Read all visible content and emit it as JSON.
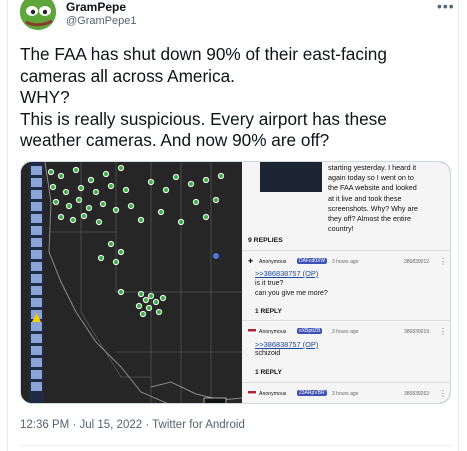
{
  "author": {
    "name": "GramPepe",
    "handle": "@GramPepe1"
  },
  "more_glyph": "•••",
  "tweet_lines": [
    "The FAA has shut down 90% of their east-facing",
    "cameras all across America.",
    "WHY?",
    "This is really suspicious. Every airport has these",
    "weather cameras. And now 90% are off?"
  ],
  "screenshot": {
    "op_lines": [
      "starting yesterday. I heard it",
      "again today so I went on to",
      "the FAA website and looked",
      "at it live and took these",
      "screenshots. Why? Why are",
      "they off? Almost the entire",
      "country!"
    ],
    "op_replies": "9 REPLIES",
    "posts": [
      {
        "user": "Anonymous",
        "id": "DAFcd0XW",
        "time": "3 hours ago",
        "number": "386839012",
        "quote": ">>386838757 (OP)",
        "lines": [
          "is it true?",
          "can you give me more?"
        ],
        "replies": "1 REPLY"
      },
      {
        "user": "Anonymous",
        "id": "eXBpttZB",
        "time": "3 hours ago",
        "number": "386839019",
        "quote": ">>386838757 (OP)",
        "lines": [
          "schizoid"
        ],
        "replies": "1 REPLY"
      },
      {
        "user": "Anonymous",
        "id": "23ARpVBR",
        "time": "3 hours ago",
        "number": "386839263"
      }
    ]
  },
  "meta": {
    "time": "12:36 PM",
    "date": "Jul 15, 2022",
    "source": "Twitter for Android"
  },
  "colors": {
    "badge": "#3f51b5",
    "quote": "#1a4ba0",
    "map_bg": "#262626",
    "camera_green": "#3cb043"
  }
}
